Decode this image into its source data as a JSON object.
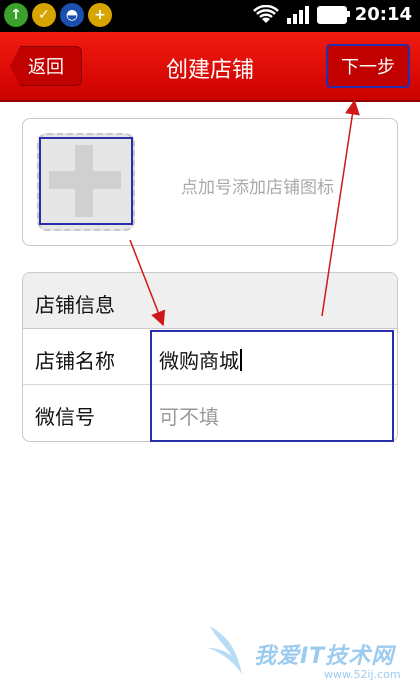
{
  "status_bar": {
    "time": "20:14",
    "icons": [
      "upload-icon",
      "check-badge-icon",
      "qq-penguin-icon",
      "plus-badge-icon"
    ],
    "wifi_icon": "wifi-icon",
    "signal_icon": "signal-icon",
    "battery_icon": "battery-icon"
  },
  "header": {
    "back_label": "返回",
    "title": "创建店铺",
    "next_label": "下一步"
  },
  "logo_section": {
    "add_icon": "plus-icon",
    "hint": "点加号添加店铺图标"
  },
  "shop_info": {
    "section_title": "店铺信息",
    "fields": [
      {
        "label": "店铺名称",
        "value": "微购商城",
        "placeholder": ""
      },
      {
        "label": "微信号",
        "value": "",
        "placeholder": "可不填"
      }
    ]
  },
  "watermark": {
    "text": "我爱IT技术网",
    "url": "www.52ij.com"
  },
  "colors": {
    "header_red": "#e01008",
    "annotation_blue": "#2a2ea8",
    "annotation_arrow": "#d01818"
  }
}
